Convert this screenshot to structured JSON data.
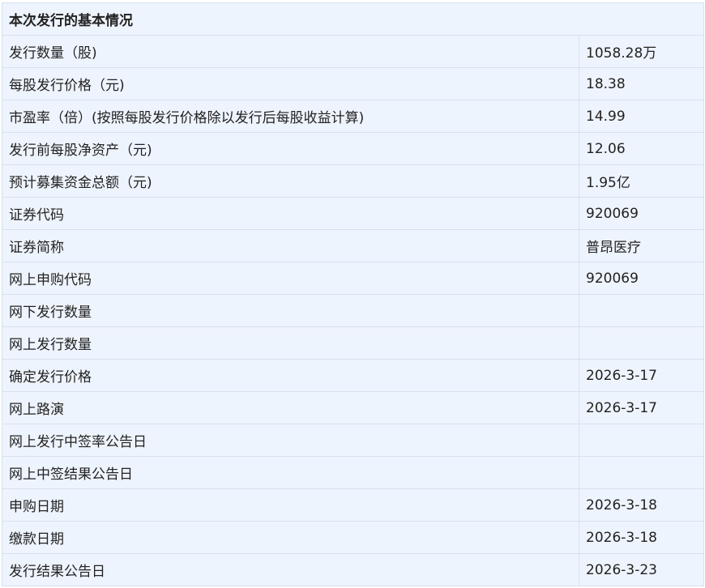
{
  "table": {
    "title": "本次发行的基本情况",
    "rows": [
      {
        "label": "发行数量（股)",
        "value": "1058.28万"
      },
      {
        "label": "每股发行价格（元)",
        "value": "18.38"
      },
      {
        "label": "市盈率（倍）(按照每股发行价格除以发行后每股收益计算)",
        "value": "14.99"
      },
      {
        "label": "发行前每股净资产（元)",
        "value": "12.06"
      },
      {
        "label": "预计募集资金总额（元)",
        "value": "1.95亿"
      },
      {
        "label": "证券代码",
        "value": "920069"
      },
      {
        "label": "证券简称",
        "value": "普昂医疗"
      },
      {
        "label": "网上申购代码",
        "value": "920069"
      },
      {
        "label": "网下发行数量",
        "value": ""
      },
      {
        "label": "网上发行数量",
        "value": ""
      },
      {
        "label": "确定发行价格",
        "value": "2026-3-17"
      },
      {
        "label": "网上路演",
        "value": "2026-3-17"
      },
      {
        "label": "网上发行中签率公告日",
        "value": ""
      },
      {
        "label": "网上中签结果公告日",
        "value": ""
      },
      {
        "label": "申购日期",
        "value": "2026-3-18"
      },
      {
        "label": "缴款日期",
        "value": "2026-3-18"
      },
      {
        "label": "发行结果公告日",
        "value": "2026-3-23"
      }
    ]
  }
}
